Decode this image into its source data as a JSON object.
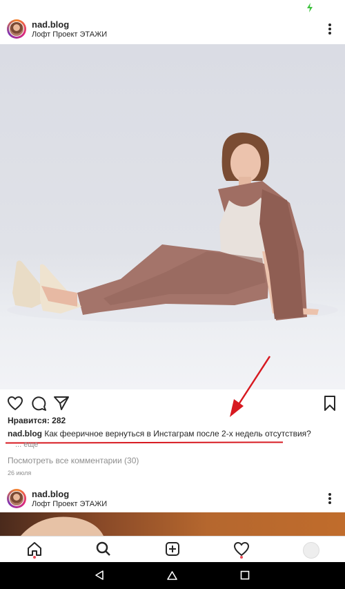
{
  "post": {
    "username": "nad.blog",
    "location": "Лофт Проект ЭТАЖИ",
    "likes": "Нравится: 282",
    "caption_user": "nad.blog",
    "caption_text": "Как фееричное вернуться в Инстаграм после 2-х недель отсутствия?",
    "more": "... еще",
    "view_comments": "Посмотреть все комментарии (30)",
    "date": "26 июля"
  },
  "next_post": {
    "username": "nad.blog",
    "location": "Лофт Проект ЭТАЖИ"
  },
  "colors": {
    "annotation": "#d71920",
    "notification_dot": "#ed4956",
    "battery": "#3ec23e"
  },
  "icons": [
    "heart-icon",
    "comment-icon",
    "share-icon",
    "bookmark-icon",
    "home-icon",
    "search-icon",
    "add-post-icon",
    "activity-icon",
    "profile-icon",
    "back-icon",
    "home-nav-icon",
    "recents-icon"
  ]
}
